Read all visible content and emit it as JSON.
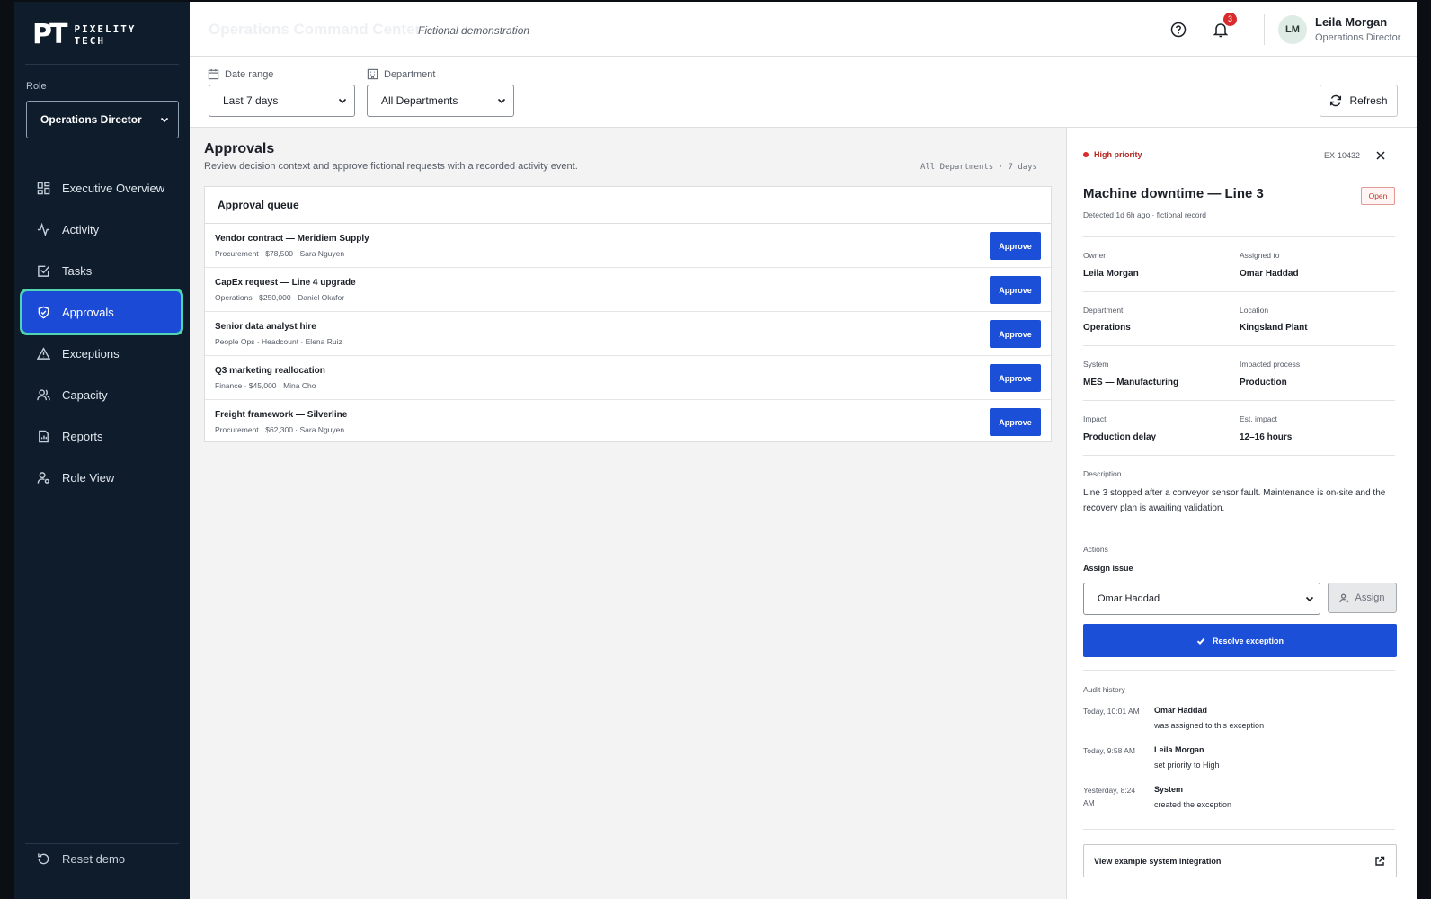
{
  "brand": {
    "mark": "PT",
    "line1": "PIXELITY",
    "line2": "TECH"
  },
  "sidebar": {
    "role_label": "Role",
    "role_value": "Operations Director",
    "items": [
      {
        "label": "Executive Overview",
        "icon": "grid-icon"
      },
      {
        "label": "Activity",
        "icon": "activity-icon"
      },
      {
        "label": "Tasks",
        "icon": "checkbox-icon"
      },
      {
        "label": "Approvals",
        "icon": "shield-check-icon",
        "active": true
      },
      {
        "label": "Exceptions",
        "icon": "warning-triangle-icon"
      },
      {
        "label": "Capacity",
        "icon": "users-icon"
      },
      {
        "label": "Reports",
        "icon": "report-icon"
      },
      {
        "label": "Role View",
        "icon": "user-settings-icon"
      }
    ],
    "reset_label": "Reset demo"
  },
  "header": {
    "title": "Operations Command Center",
    "subtitle": "Fictional demonstration",
    "notification_count": "3",
    "user_initials": "LM",
    "user_name": "Leila Morgan",
    "user_role": "Operations Director"
  },
  "filters": {
    "date_label": "Date range",
    "date_value": "Last 7 days",
    "dept_label": "Department",
    "dept_value": "All Departments",
    "refresh_label": "Refresh"
  },
  "main": {
    "title": "Approvals",
    "description": "Review decision context and approve fictional requests with a recorded activity event.",
    "meta": "All Departments · 7 days",
    "queue_title": "Approval queue",
    "approve_label": "Approve",
    "rows": [
      {
        "title": "Vendor contract — Meridiem Supply",
        "sub": "Procurement · $78,500 · Sara Nguyen"
      },
      {
        "title": "CapEx request — Line 4 upgrade",
        "sub": "Operations · $250,000 · Daniel Okafor"
      },
      {
        "title": "Senior data analyst hire",
        "sub": "People Ops · Headcount · Elena Ruiz"
      },
      {
        "title": "Q3 marketing reallocation",
        "sub": "Finance · $45,000 · Mina Cho"
      },
      {
        "title": "Freight framework — Silverline",
        "sub": "Procurement · $62,300 · Sara Nguyen"
      }
    ]
  },
  "detail": {
    "priority": "High priority",
    "id": "EX-10432",
    "title": "Machine downtime — Line 3",
    "status": "Open",
    "detected": "Detected 1d 6h ago · fictional record",
    "owner_label": "Owner",
    "owner": "Leila Morgan",
    "assigned_label": "Assigned to",
    "assigned": "Omar Haddad",
    "department_label": "Department",
    "department": "Operations",
    "location_label": "Location",
    "location": "Kingsland Plant",
    "system_label": "System",
    "system": "MES — Manufacturing",
    "process_label": "Impacted process",
    "process": "Production",
    "impact_label": "Impact",
    "impact": "Production delay",
    "est_label": "Est. impact",
    "est": "12–16 hours",
    "description_label": "Description",
    "description": "Line 3 stopped after a conveyor sensor fault. Maintenance is on-site and the recovery plan is awaiting validation.",
    "actions_label": "Actions",
    "assign_issue_label": "Assign issue",
    "assign_select": "Omar Haddad",
    "assign_button": "Assign",
    "resolve_button": "Resolve exception",
    "audit_label": "Audit history",
    "audit": [
      {
        "time": "Today, 10:01 AM",
        "who": "Omar Haddad",
        "what": "was assigned to this exception"
      },
      {
        "time": "Today, 9:58 AM",
        "who": "Leila Morgan",
        "what": "set priority to High"
      },
      {
        "time": "Yesterday, 8:24 AM",
        "who": "System",
        "what": "created the exception"
      }
    ],
    "integration_label": "View example system integration"
  },
  "colors": {
    "accent": "#1c4fd8",
    "sidebar": "#0f1c2b",
    "active_ring": "#4fd5b0",
    "danger": "#d92b2b"
  }
}
